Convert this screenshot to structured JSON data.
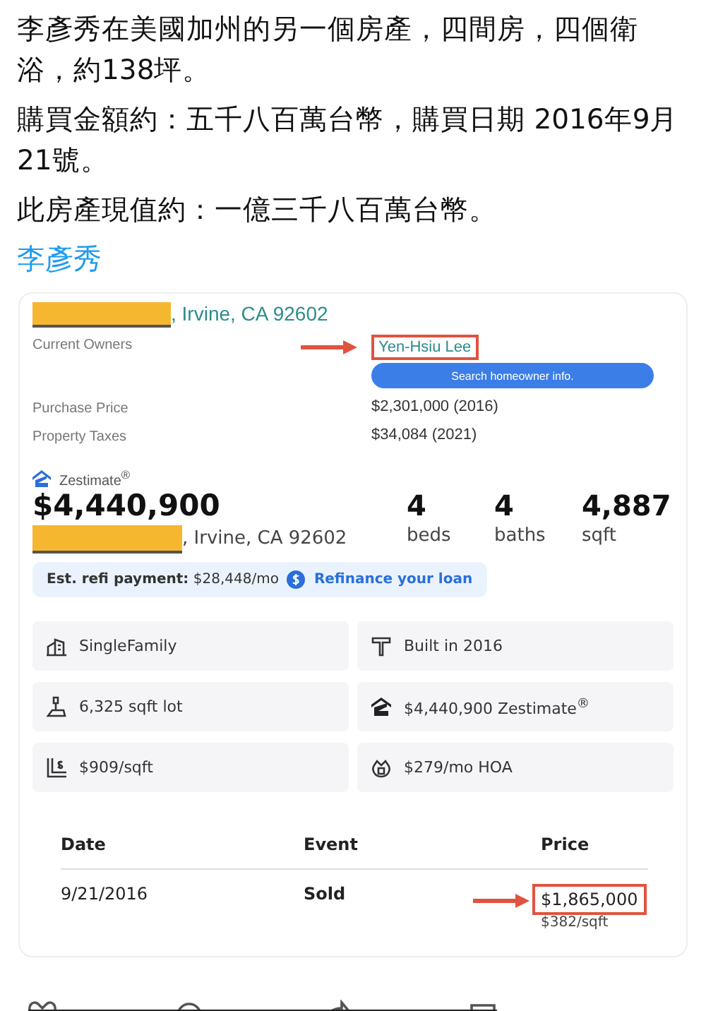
{
  "post": {
    "paragraphs": [
      "李彥秀在美國加州的另一個房產，四間房，四個衛浴，約138坪。",
      "購買金額約：五千八百萬台幣，購買日期 2016年9月21號。",
      "此房產現值約：一億三千八百萬台幣。"
    ],
    "link": "李彥秀"
  },
  "card": {
    "header_address": ", Irvine, CA 92602",
    "facts": [
      {
        "label": "Current Owners",
        "value": "Yen-Hsiu Lee",
        "kind": "owner",
        "highlighted": true
      },
      {
        "label": "Purchase Price",
        "value": "$2,301,000 (2016)",
        "kind": "plain",
        "highlighted": false
      },
      {
        "label": "Property Taxes",
        "value": "$34,084 (2021)",
        "kind": "plain",
        "highlighted": false
      }
    ],
    "search_button": "Search homeowner info.",
    "zestimate_label": "Zestimate$^{®}$",
    "price": "$4,440,900",
    "address": ", Irvine, CA 92602",
    "stats": [
      {
        "value": "4",
        "unit": "beds"
      },
      {
        "value": "4",
        "unit": "baths"
      },
      {
        "value": "4,887",
        "unit": "sqft"
      }
    ],
    "refi": {
      "label": "Est. refi payment:",
      "amount": "$28,448/mo",
      "link": "Refinance your loan"
    },
    "features": [
      {
        "kind": "house",
        "text": "SingleFamily"
      },
      {
        "kind": "hammer",
        "text": "Built in 2016"
      },
      {
        "kind": "lot",
        "text": "6,325 sqft lot"
      },
      {
        "kind": "zestimate",
        "text": "$4,440,900 Zestimate$^{®}$"
      },
      {
        "kind": "price",
        "text": "$909/sqft"
      },
      {
        "kind": "hoa",
        "text": "$279/mo HOA"
      }
    ],
    "history": {
      "columns": [
        "Date",
        "Event",
        "Price"
      ],
      "rows": [
        {
          "date": "9/21/2016",
          "event": "Sold",
          "price": "$1,865,000",
          "per_sqft": "$382/sqft",
          "highlighted": true
        }
      ]
    }
  }
}
